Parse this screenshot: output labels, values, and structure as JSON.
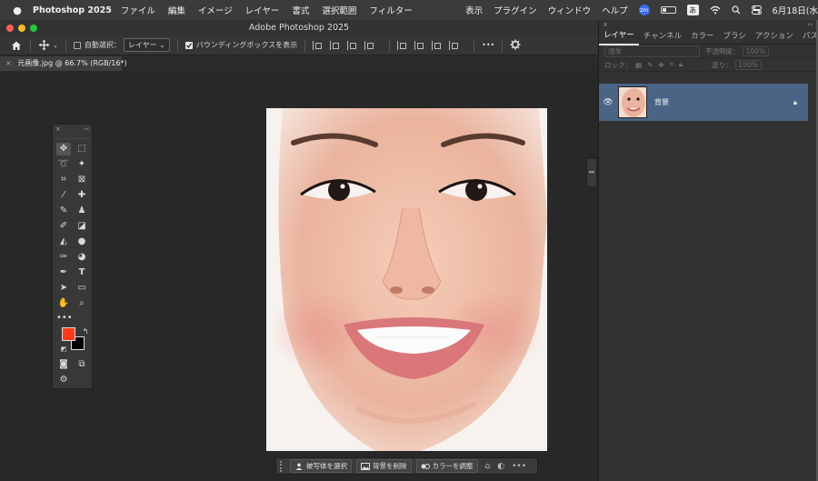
{
  "menubar": {
    "app_name": "Photoshop 2025",
    "items": [
      "ファイル",
      "編集",
      "イメージ",
      "レイヤー",
      "書式",
      "選択範囲",
      "フィルター"
    ],
    "right_items": [
      "表示",
      "プラグイン",
      "ウィンドウ",
      "ヘルプ"
    ],
    "zoom_badge": "zm",
    "ime_label": "あ",
    "date": "6月18日(水"
  },
  "window": {
    "title": "Adobe Photoshop 2025"
  },
  "options_bar": {
    "auto_select_label": "自動選択：",
    "auto_select_value": "レイヤー",
    "bounding_box_label": "バウンディングボックスを表示",
    "more_label": "•••"
  },
  "document": {
    "tab_label": "元画像.jpg @ 66.7% (RGB/16*)"
  },
  "tools_panel": {
    "close": "×",
    "collapse": "‹‹",
    "foreground_color": "#ff3b1a",
    "background_color": "#000000",
    "more_tools": "•••"
  },
  "layers_panel": {
    "close": "×",
    "collapse": "‹‹",
    "tabs": [
      "レイヤー",
      "チャンネル",
      "カラー",
      "ブラシ",
      "アクション",
      "パス"
    ],
    "blend_mode": "通常",
    "opacity_label": "不透明度：",
    "opacity_value": "100%",
    "lock_label": "ロック：",
    "fill_label": "塗り：",
    "fill_value": "100%",
    "layer_name": "背景"
  },
  "taskbar": {
    "select_subject": "被写体を選択",
    "remove_background": "背景を削除",
    "adjust_color": "カラーを調整"
  },
  "colors": {
    "panel_bg": "#323232",
    "selected_layer": "#4b6485",
    "canvas_bg": "#282828"
  }
}
